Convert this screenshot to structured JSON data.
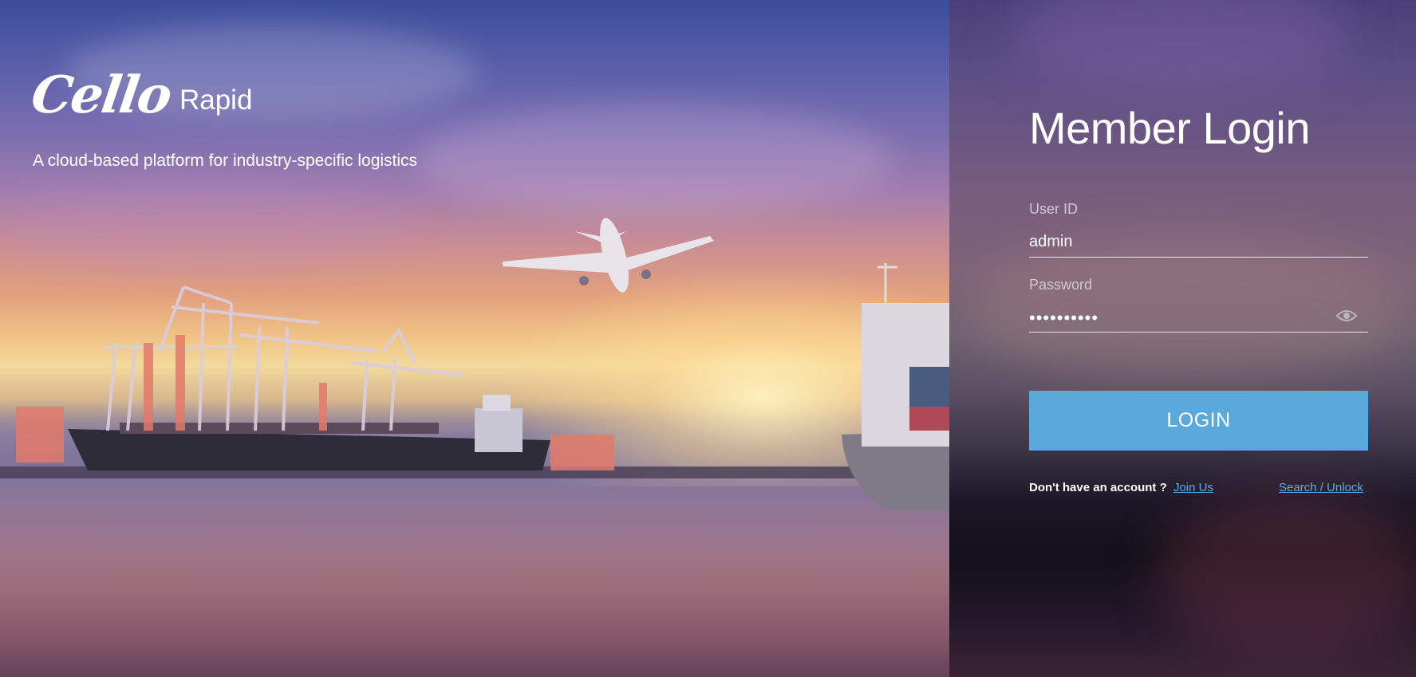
{
  "brand": {
    "logo_text": "Cello",
    "product": "Rapid",
    "tagline": "A cloud-based platform for industry-specific logistics"
  },
  "login": {
    "title": "Member Login",
    "user_id": {
      "label": "User ID",
      "value": "admin"
    },
    "password": {
      "label": "Password",
      "masked_value": "••••••••••",
      "toggle_icon": "eye-icon"
    },
    "submit_label": "LOGIN",
    "signup_prompt": "Don't have an account ?",
    "signup_link": "Join Us",
    "search_unlock_link": "Search / Unlock"
  },
  "colors": {
    "accent_button": "#5aa9dc",
    "link": "#5aaedf",
    "text": "#ffffff"
  }
}
